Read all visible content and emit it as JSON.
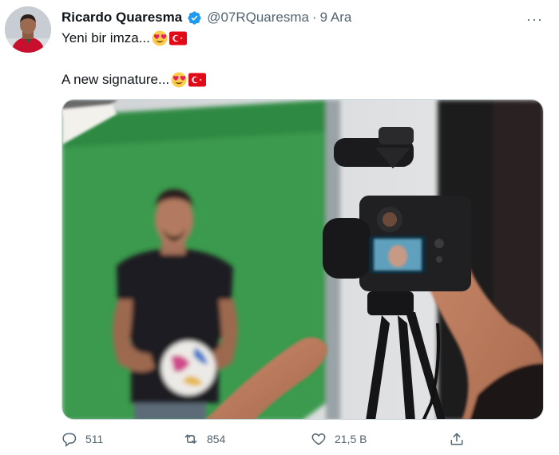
{
  "tweet": {
    "author_name": "Ricardo Quaresma",
    "handle": "@07RQuaresma",
    "separator": "·",
    "date": "9 Ara",
    "more_label": "···",
    "text_line_1": "Yeni bir imza...",
    "text_line_2": "A new signature...",
    "emojis": [
      "heart-eyes",
      "turkey-flag"
    ]
  },
  "actions": {
    "replies": "511",
    "retweets": "854",
    "likes": "21,5 B"
  },
  "colors": {
    "verified": "#1d9bf0",
    "muted": "#536471",
    "flag_red": "#e30a17",
    "green_screen": "#3a9a4e"
  }
}
